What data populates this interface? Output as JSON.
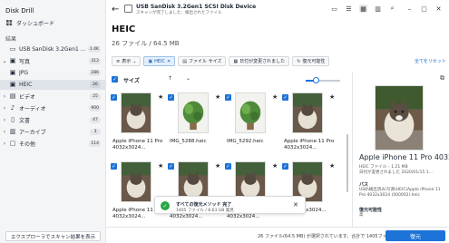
{
  "app": {
    "title": "Disk Drill"
  },
  "sidebar": {
    "dashboard_label": "ダッシュボード",
    "section_label": "結果",
    "items": [
      {
        "label": "USB  SanDisk 3.2Gen1 SCS...",
        "count": "1.4K",
        "icon": "drive-icon",
        "chevron": ""
      },
      {
        "label": "写真",
        "count": "312",
        "icon": "photo-icon",
        "chevron": "⌄"
      },
      {
        "label": "JPG",
        "count": "286",
        "icon": "image-icon",
        "chevron": ""
      },
      {
        "label": "HEIC",
        "count": "26",
        "icon": "image-icon",
        "chevron": ""
      },
      {
        "label": "ビデオ",
        "count": "25",
        "icon": "video-icon",
        "chevron": "›"
      },
      {
        "label": "オーディオ",
        "count": "900",
        "icon": "audio-icon",
        "chevron": "›"
      },
      {
        "label": "文書",
        "count": "47",
        "icon": "document-icon",
        "chevron": "›"
      },
      {
        "label": "アーカイブ",
        "count": "3",
        "icon": "archive-icon",
        "chevron": "›"
      },
      {
        "label": "その他",
        "count": "114",
        "icon": "other-icon",
        "chevron": "›"
      }
    ],
    "scan_button": "エクスプローラでスキャン結果を表示"
  },
  "header": {
    "device_title": "USB  SanDisk 3.2Gen1 SCSI Disk Device",
    "device_subtitle": "スキャンが完了しました：検出されたファイル",
    "heading": "HEIC",
    "summary": "26 ファイル / 64.5 MB"
  },
  "filters": {
    "view": "表示",
    "heic": "HEIC",
    "file_size": "ファイル サイズ",
    "date_changed": "日付が変更されました",
    "recovery_chance": "復元可能性",
    "reset_all": "全てをリセット"
  },
  "list": {
    "size_label": "サイズ"
  },
  "tiles": [
    {
      "name": "Apple iPhone 11 Pro 4032x3024...",
      "thumb": "cat"
    },
    {
      "name": "IMG_5288.heic",
      "thumb": "plant"
    },
    {
      "name": "IMG_5292.heic",
      "thumb": "plant"
    },
    {
      "name": "Apple iPhone 11 Pro 4032x3024...",
      "thumb": "cat"
    },
    {
      "name": "Apple iPhone 11 Pro 4032x3024...",
      "thumb": "cat"
    },
    {
      "name": "Apple iPhone 11 Pro 4032x3024...",
      "thumb": "cat"
    },
    {
      "name": "Apple iPhone 11 Pro 4032x3024...",
      "thumb": "cat"
    },
    {
      "name": "file 4032x3024...",
      "thumb": "cat"
    }
  ],
  "toast": {
    "title": "すべての復元メソッド 完了",
    "detail": "1405 ファイル / 8.63 GB 発見"
  },
  "preview": {
    "name": "Apple iPhone 11 Pro 4032...",
    "meta_line1": "HEIC ファイル – 1.21 MB",
    "meta_line2": "日付が変更されました 2020/01/15 1...",
    "path_label": "パス",
    "path_value": "USB\\検出済み\\写真\\HEIC\\Apple iPhone 11 Pro 4032x3024 (000002).heic",
    "recovery_label": "復元可能性",
    "recovery_value": "高"
  },
  "footer": {
    "status": "26 ファイル(64.5 MB) が選択されています。合計で 1405ファイルです。",
    "recover_button": "復元"
  },
  "colors": {
    "accent": "#1d73d8",
    "success": "#28a745"
  }
}
